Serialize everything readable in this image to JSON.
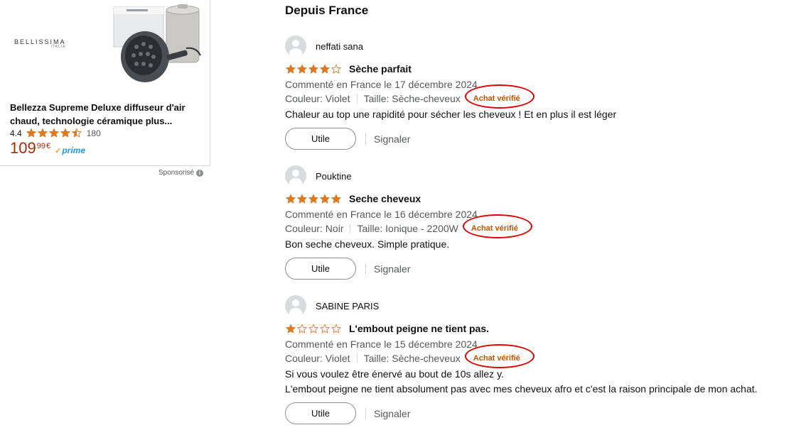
{
  "ad": {
    "brand": "BELLISSIMA",
    "brand_sub": "ITALIA",
    "title": "Bellezza Supreme Deluxe diffuseur d'air chaud, technologie céramique plus...",
    "rating": "4.4",
    "rating_value": 4.5,
    "rating_count": "180",
    "price_whole": "109",
    "price_fraction": "99",
    "price_currency": "€",
    "prime_label": "prime",
    "sponsored_label": "Sponsorisé"
  },
  "reviews_section": {
    "title": "Depuis France",
    "reviews": [
      {
        "author": "neffati sana",
        "rating": 4,
        "title": "Sèche parfait",
        "date_line": "Commenté en France le 17 décembre 2024",
        "color": "Couleur: Violet",
        "size": "Taille: Sèche-cheveux",
        "verified": "Achat vérifié",
        "body": [
          "Chaleur au top une rapidité pour sécher les cheveux ! Et en plus il est léger"
        ],
        "useful_label": "Utile",
        "report_label": "Signaler"
      },
      {
        "author": "Pouktine",
        "rating": 5,
        "title": "Seche cheveux",
        "date_line": "Commenté en France le 16 décembre 2024",
        "color": "Couleur: Noir",
        "size": "Taille: Ionique - 2200W",
        "verified": "Achat vérifié",
        "body": [
          "Bon seche cheveux. Simple pratique."
        ],
        "useful_label": "Utile",
        "report_label": "Signaler"
      },
      {
        "author": "SABINE PARIS",
        "rating": 1,
        "title": "L'embout peigne ne tient pas.",
        "date_line": "Commenté en France le 15 décembre 2024",
        "color": "Couleur: Violet",
        "size": "Taille: Sèche-cheveux",
        "verified": "Achat vérifié",
        "body": [
          "Si vous voulez être énervé au bout de 10s allez y.",
          "L'embout peigne ne tient absolument pas avec mes cheveux afro et c'est la raison principale de mon achat."
        ],
        "useful_label": "Utile",
        "report_label": "Signaler"
      }
    ]
  },
  "colors": {
    "star_fill": "#de7921",
    "price": "#b12704",
    "verified": "#c45500",
    "highlight_ring": "#e00000",
    "prime": "#1a98ff"
  }
}
